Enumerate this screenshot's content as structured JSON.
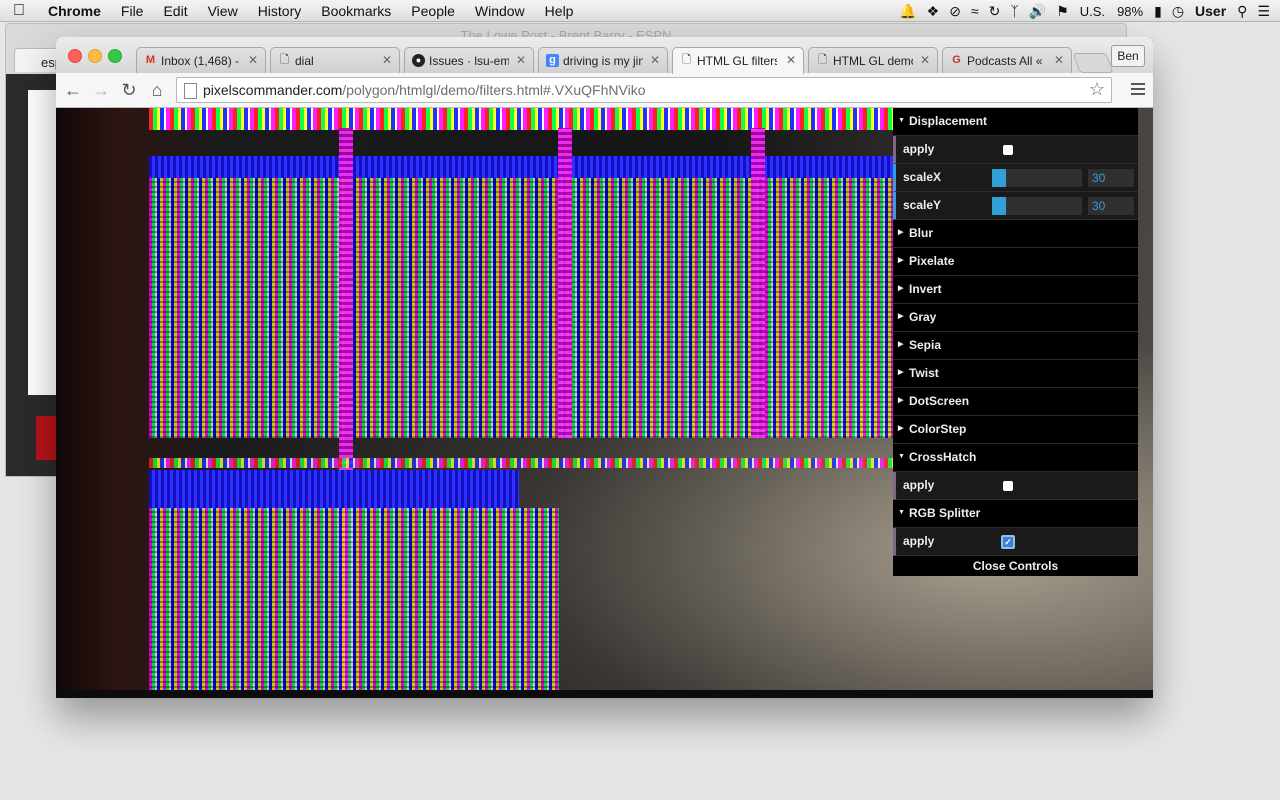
{
  "menubar": {
    "app_name": "Chrome",
    "items": [
      "File",
      "Edit",
      "View",
      "History",
      "Bookmarks",
      "People",
      "Window",
      "Help"
    ],
    "input_source": "U.S.",
    "battery": "98%",
    "user": "User"
  },
  "background_window": {
    "title": "The Lowe Post - Brent Barry - ESPN",
    "tab_label": "esp"
  },
  "browser": {
    "tabs": [
      {
        "label": "Inbox (1,468) -",
        "icon": "gmail-icon"
      },
      {
        "label": "dial",
        "icon": "page-icon"
      },
      {
        "label": "Issues · lsu-em",
        "icon": "github-icon"
      },
      {
        "label": "driving is my jin",
        "icon": "google-icon"
      },
      {
        "label": "HTML GL filters",
        "icon": "page-icon"
      },
      {
        "label": "HTML GL demo",
        "icon": "page-icon"
      },
      {
        "label": "Podcasts All «",
        "icon": "grantland-icon"
      }
    ],
    "active_tab": 4,
    "profile_name": "Ben",
    "url_host": "pixelscommander.com",
    "url_path": "/polygon/htmlgl/demo/filters.html#.VXuQFhNViko"
  },
  "controls": {
    "sections": [
      {
        "title": "Displacement",
        "open": true,
        "rows": [
          {
            "type": "bool",
            "label": "apply",
            "checked": false
          },
          {
            "type": "number",
            "label": "scaleX",
            "value": "30",
            "fill_fraction": 0.15
          },
          {
            "type": "number",
            "label": "scaleY",
            "value": "30",
            "fill_fraction": 0.15
          }
        ]
      },
      {
        "title": "Blur",
        "open": false,
        "rows": []
      },
      {
        "title": "Pixelate",
        "open": false,
        "rows": []
      },
      {
        "title": "Invert",
        "open": false,
        "rows": []
      },
      {
        "title": "Gray",
        "open": false,
        "rows": []
      },
      {
        "title": "Sepia",
        "open": false,
        "rows": []
      },
      {
        "title": "Twist",
        "open": false,
        "rows": []
      },
      {
        "title": "DotScreen",
        "open": false,
        "rows": []
      },
      {
        "title": "ColorStep",
        "open": false,
        "rows": []
      },
      {
        "title": "CrossHatch",
        "open": true,
        "rows": [
          {
            "type": "bool",
            "label": "apply",
            "checked": false
          }
        ]
      },
      {
        "title": "RGB Splitter",
        "open": true,
        "rows": [
          {
            "type": "bool",
            "label": "apply",
            "checked": true
          }
        ]
      }
    ],
    "close_label": "Close Controls"
  }
}
